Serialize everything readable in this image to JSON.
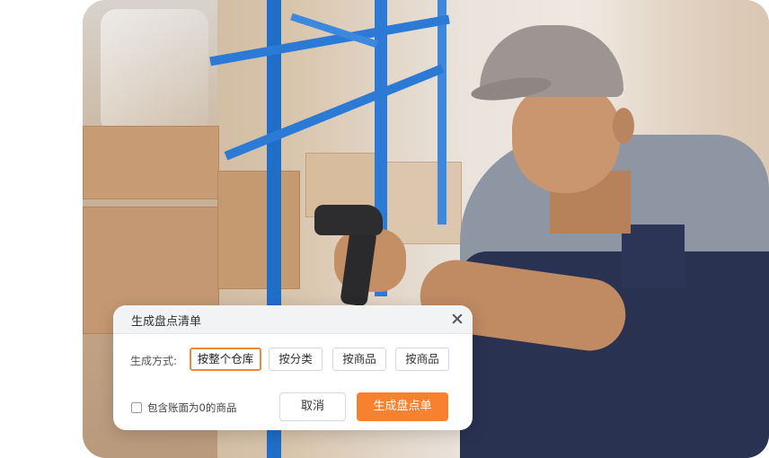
{
  "dialog": {
    "title": "生成盘点清单",
    "method_label": "生成方式:",
    "options": [
      {
        "label": "按整个仓库",
        "selected": true
      },
      {
        "label": "按分类",
        "selected": false
      },
      {
        "label": "按商品",
        "selected": false
      },
      {
        "label": "按商品",
        "selected": false
      }
    ],
    "include_zero_label": "包含账面为0的商品",
    "include_zero_checked": false,
    "cancel_label": "取消",
    "confirm_label": "生成盘点单"
  },
  "colors": {
    "accent": "#f7812e",
    "selected_border": "#f0883a"
  },
  "icons": {
    "close": "close-icon"
  }
}
